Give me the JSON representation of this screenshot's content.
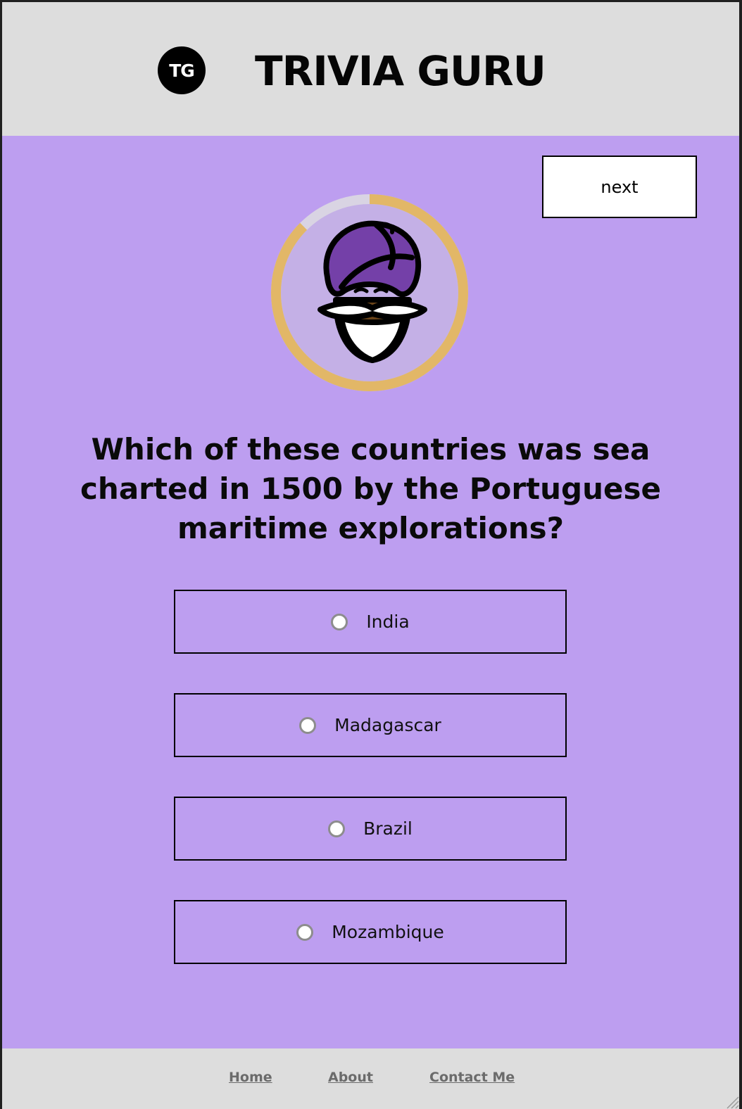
{
  "header": {
    "logo_text": "TG",
    "title": "TRIVIA GURU"
  },
  "controls": {
    "next_label": "next"
  },
  "timer": {
    "remaining_fraction": 0.97,
    "ring_color": "#e2b767",
    "elapsed_color": "#d9d4e3",
    "avatar_icon": "turbaned-guru-icon"
  },
  "quiz": {
    "question": "Which of these countries was sea charted in 1500 by the Portuguese maritime explorations?",
    "options": [
      "India",
      "Madagascar",
      "Brazil",
      "Mozambique"
    ]
  },
  "footer": {
    "links": [
      "Home",
      "About",
      "Contact Me"
    ]
  },
  "colors": {
    "header_bg": "#dddddd",
    "main_bg": "#bd9ef0",
    "turban": "#7440a8",
    "skin": "#6b4419"
  }
}
